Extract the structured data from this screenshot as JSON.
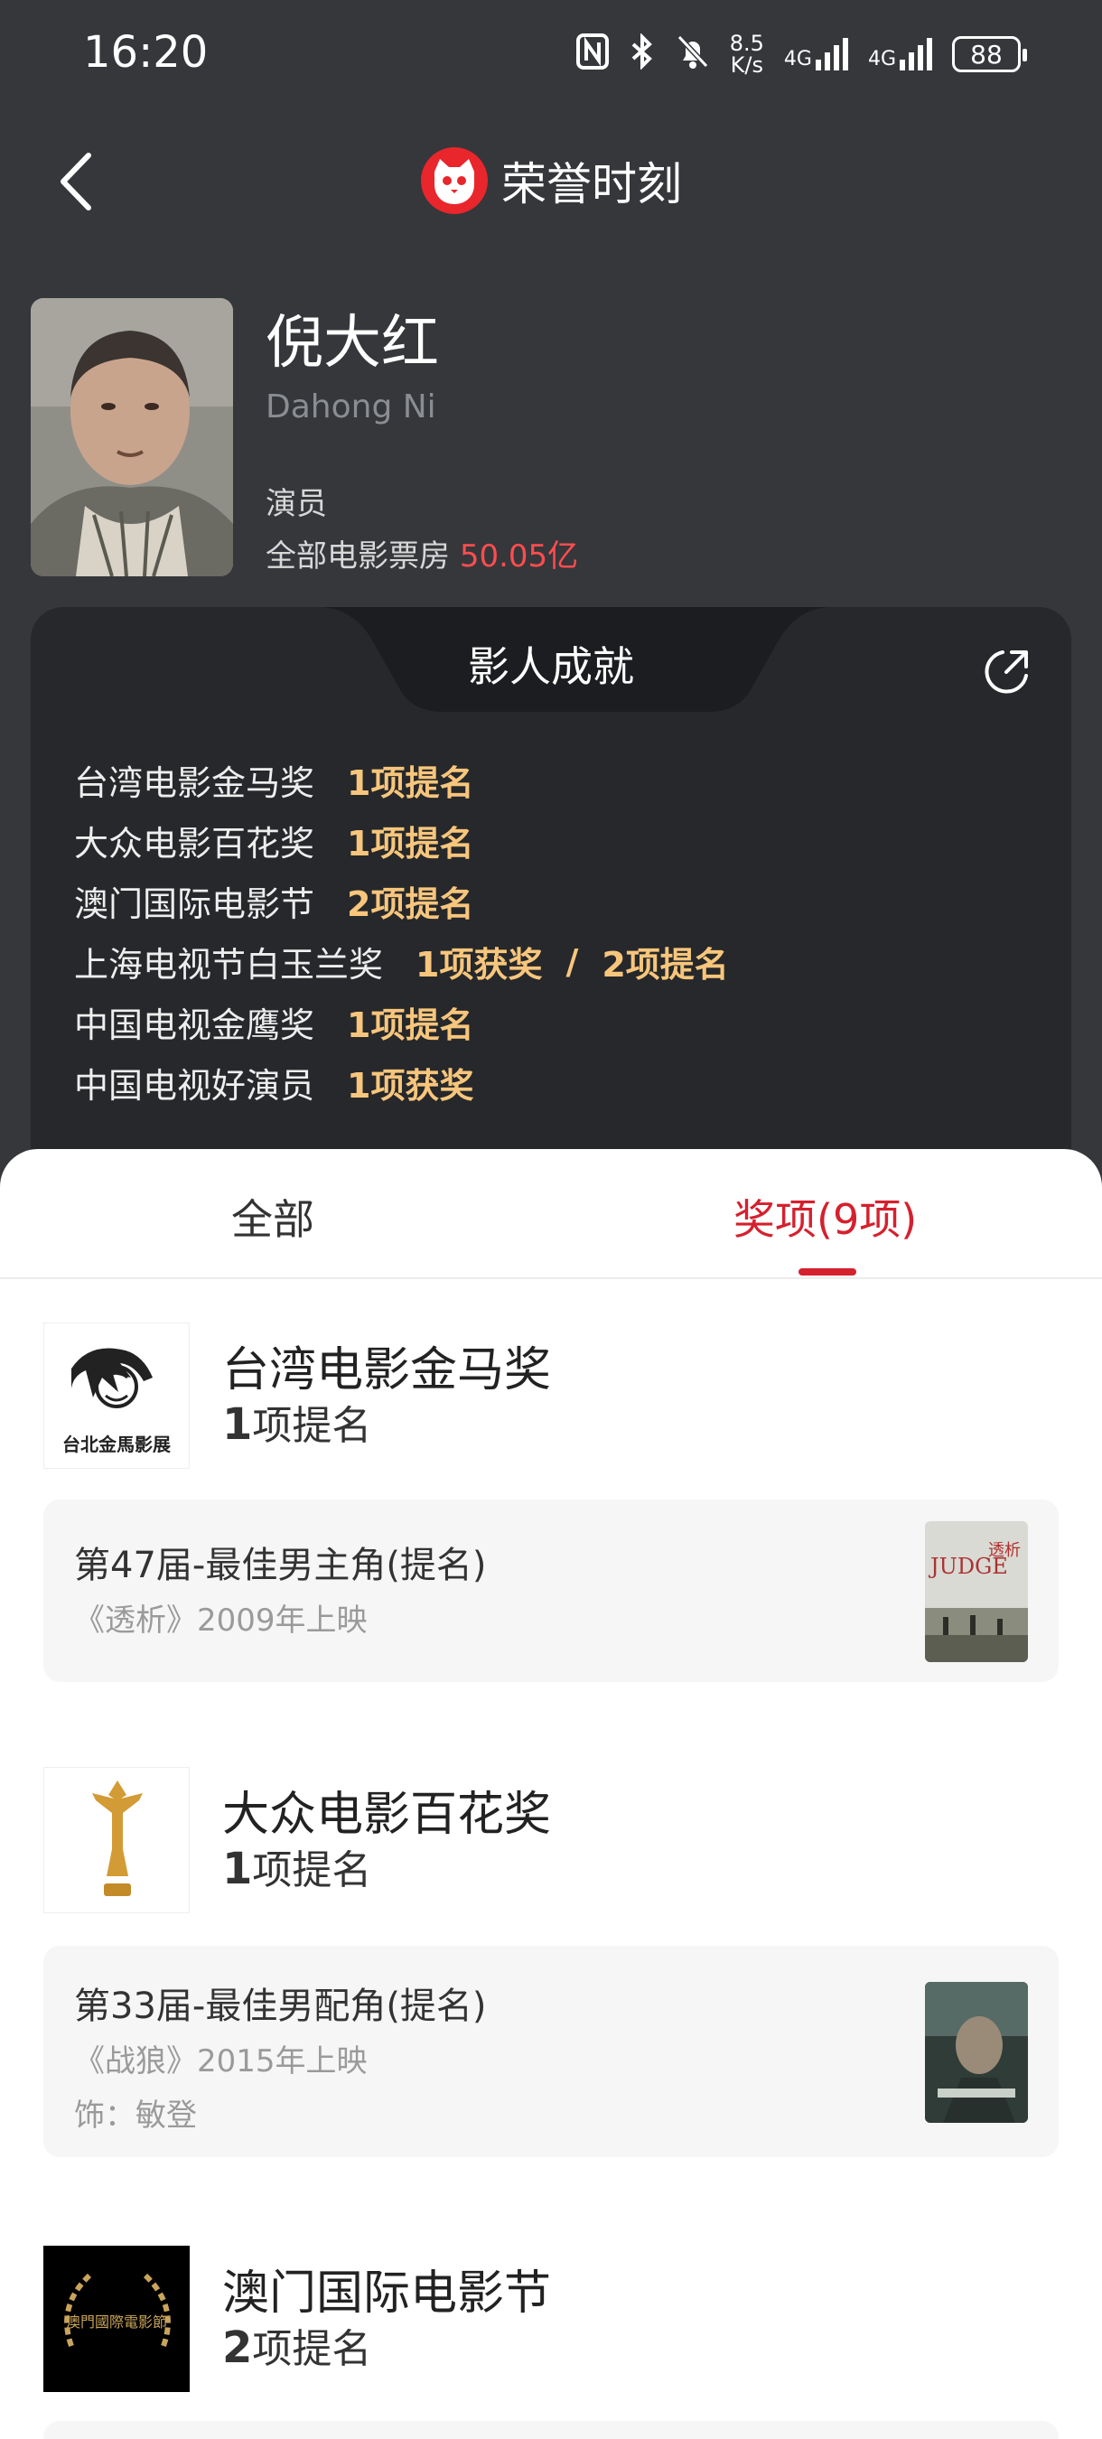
{
  "status": {
    "time": "16:20",
    "net_speed_top": "8.5",
    "net_speed_bottom": "K/s",
    "net1": "4G",
    "net2": "4G",
    "battery": "88"
  },
  "header": {
    "title": "荣誉时刻"
  },
  "profile": {
    "name": "倪大红",
    "english_name": "Dahong Ni",
    "role": "演员",
    "box_office_label": "全部电影票房",
    "box_office_value": "50.05亿"
  },
  "achievements": {
    "title": "影人成就",
    "rows": [
      {
        "award": "台湾电影金马奖",
        "count": "1项提名"
      },
      {
        "award": "大众电影百花奖",
        "count": "1项提名"
      },
      {
        "award": "澳门国际电影节",
        "count": "2项提名"
      },
      {
        "award": "上海电视节白玉兰奖",
        "count": "1项获奖",
        "sep": "/",
        "count2": "2项提名"
      },
      {
        "award": "中国电视金鹰奖",
        "count": "1项提名"
      },
      {
        "award": "中国电视好演员",
        "count": "1项获奖"
      }
    ]
  },
  "tabs": {
    "all": "全部",
    "awards": "奖项(9项)"
  },
  "awards": [
    {
      "name": "台湾电影金马奖",
      "count_num": "1",
      "count_text": "项提名",
      "logo_text": "台北金馬影展",
      "entry": {
        "title": "第47届-最佳男主角(提名)",
        "film": "《透析》2009年上映",
        "poster_title": "透析",
        "poster_sub": "JUDGE"
      }
    },
    {
      "name": "大众电影百花奖",
      "count_num": "1",
      "count_text": "项提名",
      "entry": {
        "title": "第33届-最佳男配角(提名)",
        "film": "《战狼》2015年上映",
        "role": "饰：敏登"
      }
    },
    {
      "name": "澳门国际电影节",
      "count_num": "2",
      "count_text": "项提名",
      "logo_text": "澳門國際電影節"
    }
  ],
  "colors": {
    "accent": "#d5202e",
    "gold": "#f7c67c",
    "box_red": "#ff4d4f",
    "dark_bg": "#35373b"
  }
}
